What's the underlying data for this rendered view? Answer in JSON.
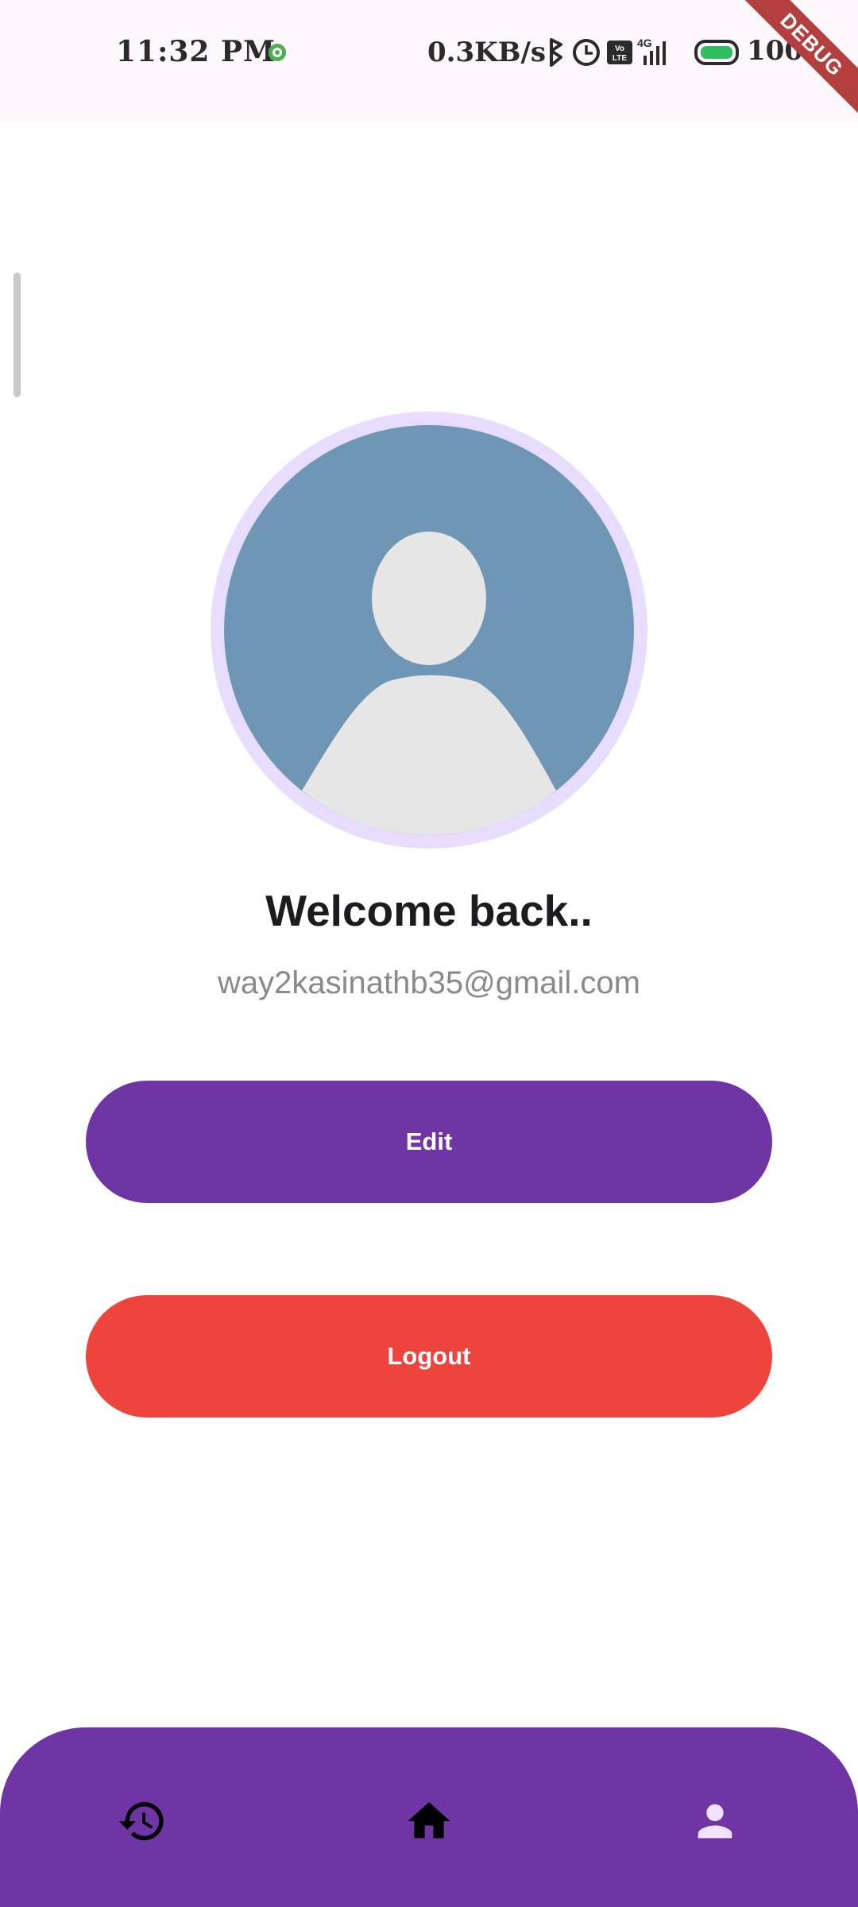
{
  "status_bar": {
    "time": "11:32 PM",
    "net_speed": "0.3KB/s",
    "battery": "100%"
  },
  "debug_banner": "DEBUG",
  "profile": {
    "welcome": "Welcome back..",
    "email": "way2kasinathb35@gmail.com"
  },
  "actions": {
    "edit_label": "Edit",
    "logout_label": "Logout"
  },
  "bottom_nav": {
    "items": [
      {
        "icon": "history-icon"
      },
      {
        "icon": "home-icon"
      },
      {
        "icon": "person-icon",
        "selected": true
      }
    ]
  },
  "colors": {
    "primary": "#6f35a5",
    "logout": "#ed443c",
    "avatar_bg": "#6f97b5",
    "avatar_ring": "#e9ddff"
  }
}
